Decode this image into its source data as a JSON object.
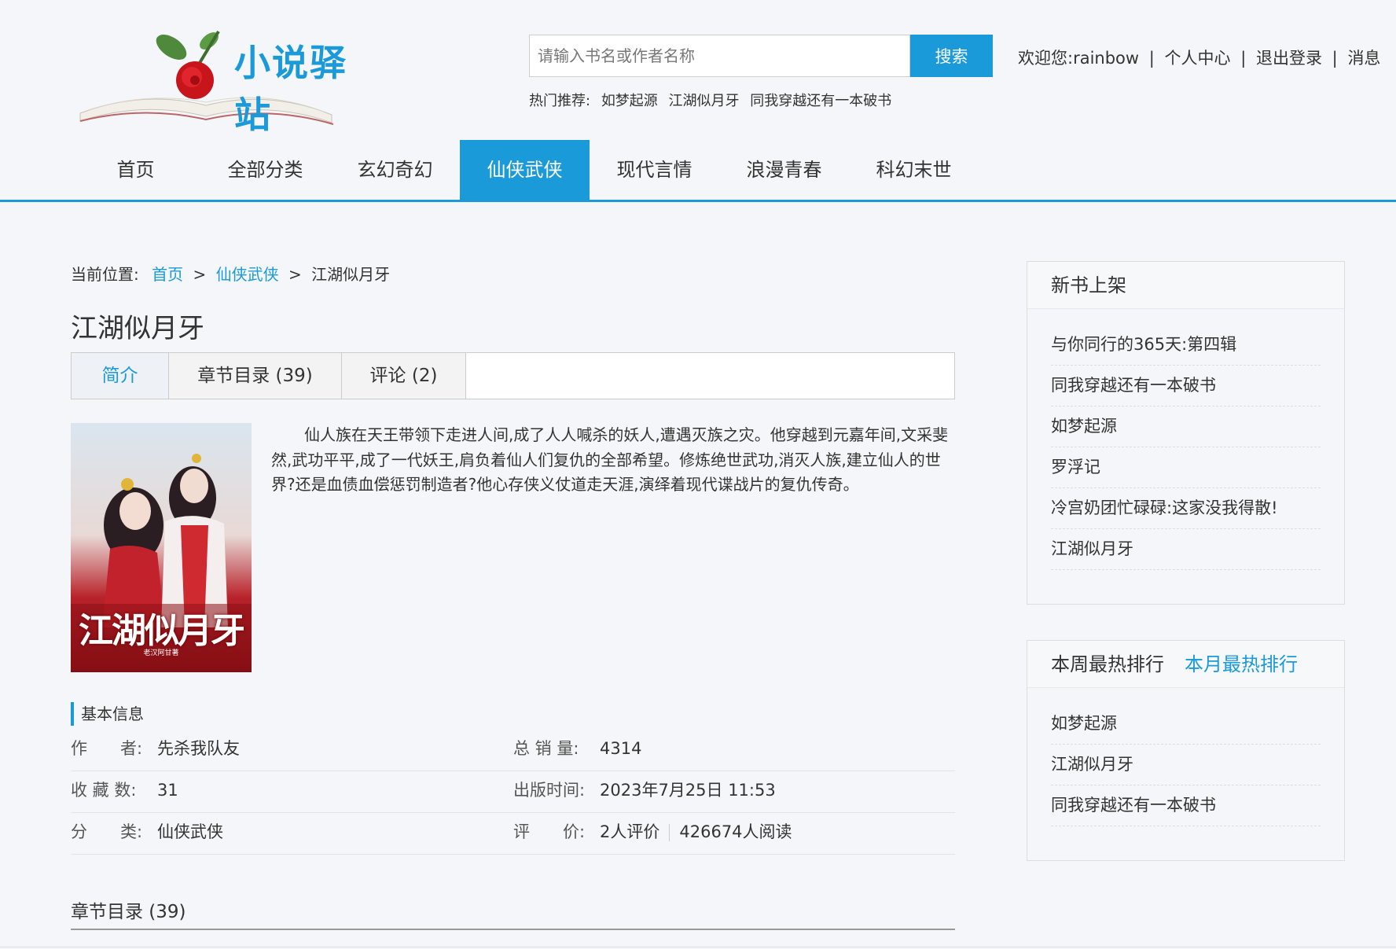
{
  "site": {
    "logo_text": "小说驿站"
  },
  "search": {
    "placeholder": "请输入书名或作者名称",
    "button": "搜索"
  },
  "hot": {
    "label": "热门推荐:",
    "items": [
      "如梦起源",
      "江湖似月牙",
      "同我穿越还有一本破书"
    ]
  },
  "user": {
    "welcome": "欢迎您:rainbow",
    "center": "个人中心",
    "logout": "退出登录",
    "messages": "消息",
    "sep": "|"
  },
  "nav": [
    "首页",
    "全部分类",
    "玄幻奇幻",
    "仙侠武侠",
    "现代言情",
    "浪漫青春",
    "科幻末世"
  ],
  "breadcrumb": {
    "label": "当前位置:",
    "home": "首页",
    "category": "仙侠武侠",
    "current": "江湖似月牙",
    "gt": ">"
  },
  "book": {
    "title": "江湖似月牙",
    "cover_title": "江湖似月牙",
    "cover_subtitle": "老汉阿甘著",
    "intro": "仙人族在天王带领下走进人间,成了人人喊杀的妖人,遭遇灭族之灾。他穿越到元嘉年间,文采斐然,武功平平,成了一代妖王,肩负着仙人们复仇的全部希望。修炼绝世武功,消灭人族,建立仙人的世界?还是血债血偿惩罚制造者?他心存侠义仗道走天涯,演绎着现代谍战片的复仇传奇。"
  },
  "tabs": [
    "简介",
    "章节目录 (39)",
    "评论 (2)"
  ],
  "info": {
    "heading": "基本信息",
    "author_label": "作　　者:",
    "author": "先杀我队友",
    "sales_label": "总 销 量:",
    "sales": "4314",
    "fav_label": "收 藏 数:",
    "fav": "31",
    "pub_label": "出版时间:",
    "pub": "2023年7月25日 11:53",
    "cat_label": "分　　类:",
    "cat": "仙侠武侠",
    "rate_label": "评　　价:",
    "rate": "2人评价",
    "reads": "426674人阅读"
  },
  "chapters": {
    "heading": "章节目录 (39)"
  },
  "sidebar": {
    "new_title": "新书上架",
    "new_items": [
      "与你同行的365天:第四辑",
      "同我穿越还有一本破书",
      "如梦起源",
      "罗浮记",
      "冷宫奶团忙碌碌:这家没我得散!",
      "江湖似月牙"
    ],
    "week_title": "本周最热排行",
    "month_title": "本月最热排行",
    "hot_items": [
      "如梦起源",
      "江湖似月牙",
      "同我穿越还有一本破书"
    ]
  }
}
